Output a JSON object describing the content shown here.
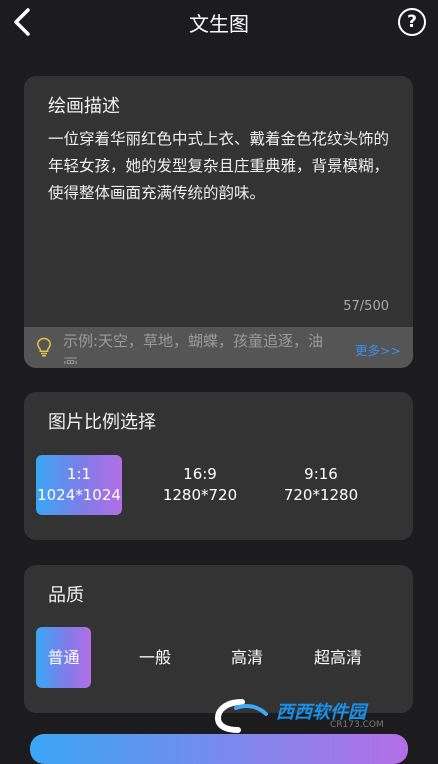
{
  "header": {
    "title": "文生图"
  },
  "description": {
    "title": "绘画描述",
    "text": "一位穿着华丽红色中式上衣、戴着金色花纹头饰的年轻女孩，她的发型复杂且庄重典雅，背景模糊，使得整体画面充满传统的韵味。",
    "counter": "57/500",
    "example": "示例:天空，草地，蝴蝶，孩童追逐，油画",
    "more": "更多>>"
  },
  "ratio": {
    "title": "图片比例选择",
    "options": [
      {
        "label": "1:1",
        "size": "1024*1024"
      },
      {
        "label": "16:9",
        "size": "1280*720"
      },
      {
        "label": "9:16",
        "size": "720*1280"
      }
    ]
  },
  "quality": {
    "title": "品质",
    "options": [
      "普通",
      "一般",
      "高清",
      "超高清"
    ]
  },
  "watermark": {
    "text": "西西软件园",
    "sub": "CR173.COM"
  },
  "colors": {
    "accent_start": "#3aa6f5",
    "accent_end": "#b46ee6",
    "link": "#3b8ef0"
  }
}
